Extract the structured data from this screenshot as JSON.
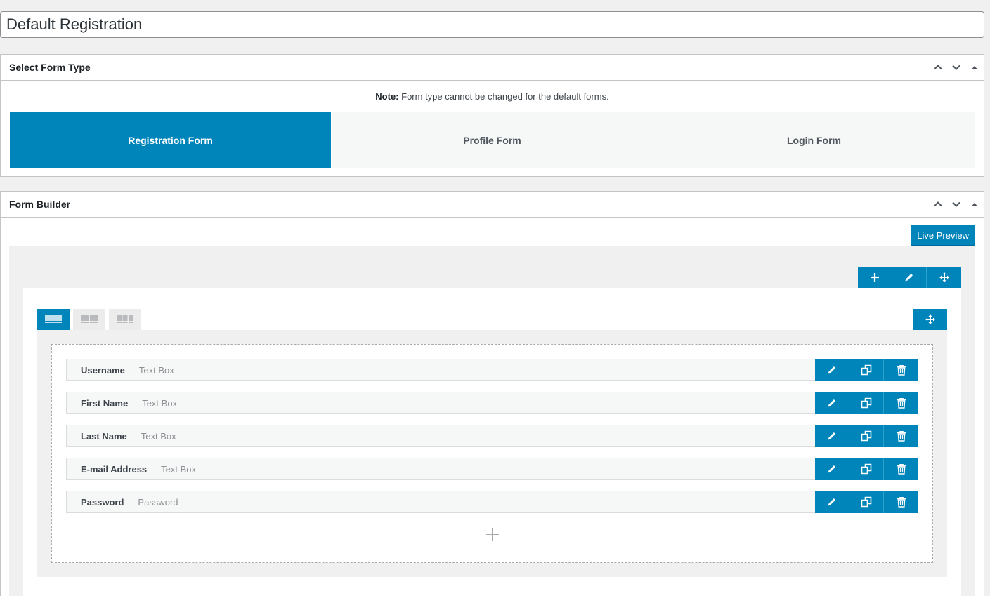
{
  "title_input": {
    "value": "Default Registration"
  },
  "form_type_box": {
    "title": "Select Form Type",
    "note_bold": "Note:",
    "note_text": " Form type cannot be changed for the default forms.",
    "tabs": [
      {
        "label": "Registration Form",
        "active": true
      },
      {
        "label": "Profile Form",
        "active": false
      },
      {
        "label": "Login Form",
        "active": false
      }
    ]
  },
  "form_builder_box": {
    "title": "Form Builder",
    "live_preview_label": "Live Preview",
    "fields": [
      {
        "label": "Username",
        "type": "Text Box"
      },
      {
        "label": "First Name",
        "type": "Text Box"
      },
      {
        "label": "Last Name",
        "type": "Text Box"
      },
      {
        "label": "E-mail Address",
        "type": "Text Box"
      },
      {
        "label": "Password",
        "type": "Password"
      }
    ]
  },
  "colors": {
    "accent": "#0085ba",
    "background": "#f0f0f1",
    "inactive_tab": "#f6f7f7"
  },
  "icons": [
    "chevron-up-icon",
    "chevron-down-icon",
    "triangle-up-icon",
    "plus-icon",
    "pencil-icon",
    "move-icon",
    "columns-1-icon",
    "columns-2-icon",
    "columns-3-icon",
    "duplicate-icon",
    "trash-icon"
  ]
}
